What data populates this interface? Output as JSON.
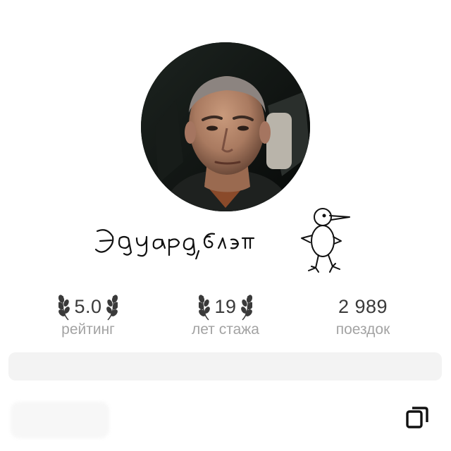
{
  "profile": {
    "name": "Эдуард, блэт",
    "avatar_icon": "driver-photo"
  },
  "stats": [
    {
      "value": "5.0",
      "label": "рейтинг",
      "laurel": true
    },
    {
      "value": "19",
      "label": "лет стажа",
      "laurel": true
    },
    {
      "value": "2 989",
      "label": "поездок",
      "laurel": false
    }
  ],
  "icons": {
    "doodle": "bird-doodle-icon",
    "copy": "copy-icon"
  },
  "colors": {
    "value_text": "#3a3a3a",
    "label_text": "#a3a3a3",
    "bar_background": "#f3f3f3",
    "icon_dark": "#111111"
  }
}
